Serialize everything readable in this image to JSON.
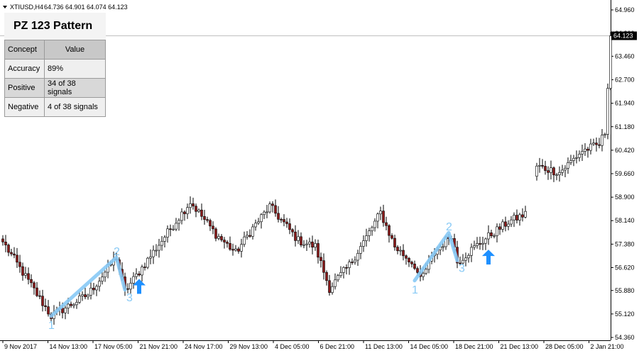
{
  "header": {
    "symbol": "XTIUSD,H4",
    "ohlc": "64.736 64.901 64.074 64.123"
  },
  "panel": {
    "title": "PZ 123 Pattern",
    "headers": [
      "Concept",
      "Value"
    ],
    "rows": [
      {
        "concept": "Accuracy",
        "value": "89%"
      },
      {
        "concept": "Positive",
        "value": "34 of 38 signals"
      },
      {
        "concept": "Negative",
        "value": "4 of 38 signals"
      }
    ]
  },
  "colors": {
    "bull": "#ffffff",
    "bear": "#8b1a1a",
    "pattern": "#87c9f5",
    "arrow": "#1e90ff",
    "price_tag": "#000000"
  },
  "chart_data": {
    "type": "candlestick",
    "symbol": "XTIUSD",
    "timeframe": "H4",
    "current_price": 64.123,
    "current_price_label": "64.123",
    "ylim": [
      54.36,
      64.96
    ],
    "y_ticks": [
      64.96,
      64.2,
      63.46,
      62.7,
      61.94,
      61.18,
      60.42,
      59.66,
      58.9,
      58.14,
      57.38,
      56.62,
      55.88,
      55.12,
      54.36
    ],
    "y_tick_labels": [
      "64.960",
      "64.200",
      "63.460",
      "62.700",
      "61.940",
      "61.180",
      "60.420",
      "59.660",
      "58.900",
      "58.140",
      "57.380",
      "56.620",
      "55.880",
      "55.120",
      "54.360"
    ],
    "x_tick_labels": [
      "9 Nov 2017",
      "14 Nov 13:00",
      "17 Nov 05:00",
      "21 Nov 21:00",
      "24 Nov 17:00",
      "29 Nov 13:00",
      "4 Dec 05:00",
      "6 Dec 21:00",
      "11 Dec 13:00",
      "14 Dec 05:00",
      "18 Dec 21:00",
      "21 Dec 13:00",
      "28 Dec 05:00",
      "2 Jan 21:00"
    ],
    "bar_count": 215,
    "segments": [
      {
        "from": [
          0,
          57.45
        ],
        "to": [
          17,
          55.05
        ]
      },
      {
        "from": [
          17,
          55.05
        ],
        "to": [
          30,
          55.75
        ]
      },
      {
        "from": [
          30,
          55.75
        ],
        "to": [
          40,
          56.95
        ]
      },
      {
        "from": [
          40,
          56.95
        ],
        "to": [
          43,
          55.85
        ]
      },
      {
        "from": [
          43,
          55.85
        ],
        "to": [
          52,
          57.0
        ]
      },
      {
        "from": [
          52,
          57.0
        ],
        "to": [
          60,
          58.0
        ]
      },
      {
        "from": [
          60,
          58.0
        ],
        "to": [
          66,
          58.75
        ]
      },
      {
        "from": [
          66,
          58.75
        ],
        "to": [
          75,
          57.7
        ]
      },
      {
        "from": [
          75,
          57.7
        ],
        "to": [
          82,
          57.1
        ]
      },
      {
        "from": [
          82,
          57.1
        ],
        "to": [
          88,
          57.9
        ]
      },
      {
        "from": [
          88,
          57.9
        ],
        "to": [
          94,
          58.6
        ]
      },
      {
        "from": [
          94,
          58.6
        ],
        "to": [
          104,
          57.5
        ]
      },
      {
        "from": [
          104,
          57.5
        ],
        "to": [
          110,
          57.3
        ]
      },
      {
        "from": [
          110,
          57.3
        ],
        "to": [
          115,
          55.95
        ]
      },
      {
        "from": [
          115,
          55.95
        ],
        "to": [
          122,
          56.7
        ]
      },
      {
        "from": [
          122,
          56.7
        ],
        "to": [
          128,
          57.6
        ]
      },
      {
        "from": [
          128,
          57.6
        ],
        "to": [
          133,
          58.4
        ]
      },
      {
        "from": [
          133,
          58.4
        ],
        "to": [
          138,
          57.3
        ]
      },
      {
        "from": [
          138,
          57.3
        ],
        "to": [
          145,
          56.7
        ]
      },
      {
        "from": [
          145,
          56.7
        ],
        "to": [
          147,
          56.2
        ]
      },
      {
        "from": [
          147,
          56.2
        ],
        "to": [
          152,
          57.1
        ]
      },
      {
        "from": [
          152,
          57.1
        ],
        "to": [
          158,
          57.7
        ]
      },
      {
        "from": [
          158,
          57.7
        ],
        "to": [
          160,
          56.8
        ]
      },
      {
        "from": [
          160,
          56.8
        ],
        "to": [
          165,
          57.2
        ]
      },
      {
        "from": [
          165,
          57.2
        ],
        "to": [
          172,
          57.7
        ]
      },
      {
        "from": [
          172,
          57.7
        ],
        "to": [
          178,
          58.1
        ]
      },
      {
        "from": [
          178,
          58.1
        ],
        "to": [
          184,
          58.35
        ]
      },
      {
        "from": [
          184,
          58.35
        ],
        "to": [
          188,
          59.9
        ]
      },
      {
        "from": [
          188,
          59.9
        ],
        "to": [
          196,
          59.7
        ]
      },
      {
        "from": [
          196,
          59.7
        ],
        "to": [
          204,
          60.4
        ]
      },
      {
        "from": [
          204,
          60.4
        ],
        "to": [
          210,
          60.6
        ]
      },
      {
        "from": [
          210,
          60.6
        ],
        "to": [
          212,
          61.0
        ]
      },
      {
        "from": [
          212,
          61.0
        ],
        "to": [
          214,
          64.1
        ]
      }
    ],
    "patterns": [
      {
        "points": [
          [
            17,
            55.05
          ],
          [
            40,
            56.95
          ],
          [
            43,
            55.9
          ]
        ],
        "labels": [
          "1",
          "2",
          "3"
        ]
      },
      {
        "points": [
          [
            145,
            56.2
          ],
          [
            157,
            57.75
          ],
          [
            160,
            56.85
          ]
        ],
        "labels": [
          "1",
          "2",
          "3"
        ]
      }
    ],
    "signals": [
      {
        "bar": 48,
        "price": 56.0
      },
      {
        "bar": 171,
        "price": 56.95
      }
    ]
  }
}
